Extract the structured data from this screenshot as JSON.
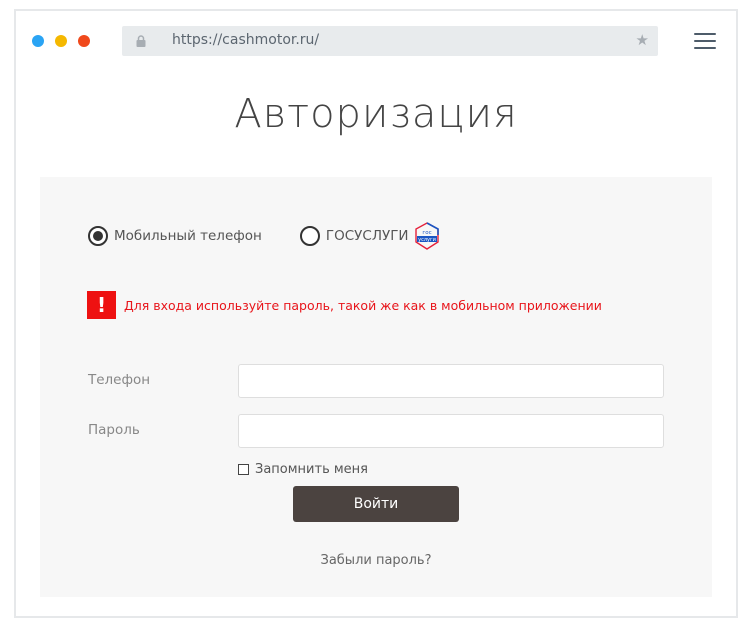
{
  "browser": {
    "url": "https://cashmotor.ru/",
    "window_dot_colors": [
      "#2aa4f4",
      "#f5b800",
      "#f0491b"
    ]
  },
  "page": {
    "title": "Авторизация"
  },
  "auth_method": {
    "options": [
      {
        "label": "Мобильный телефон",
        "selected": true
      },
      {
        "label": "ГОСУСЛУГИ",
        "selected": false
      }
    ],
    "gosuslugi_logo_text": [
      "гос",
      "услуги"
    ]
  },
  "notice": {
    "icon": "!",
    "text": "Для входа используйте пароль, такой же как в мобильном приложении",
    "color": "#ee1111"
  },
  "form": {
    "phone_label": "Телефон",
    "phone_value": "",
    "password_label": "Пароль",
    "password_value": "",
    "remember_label": "Запомнить меня",
    "remember_checked": false,
    "submit_label": "Войти",
    "forgot_label": "Забыли пароль?"
  }
}
